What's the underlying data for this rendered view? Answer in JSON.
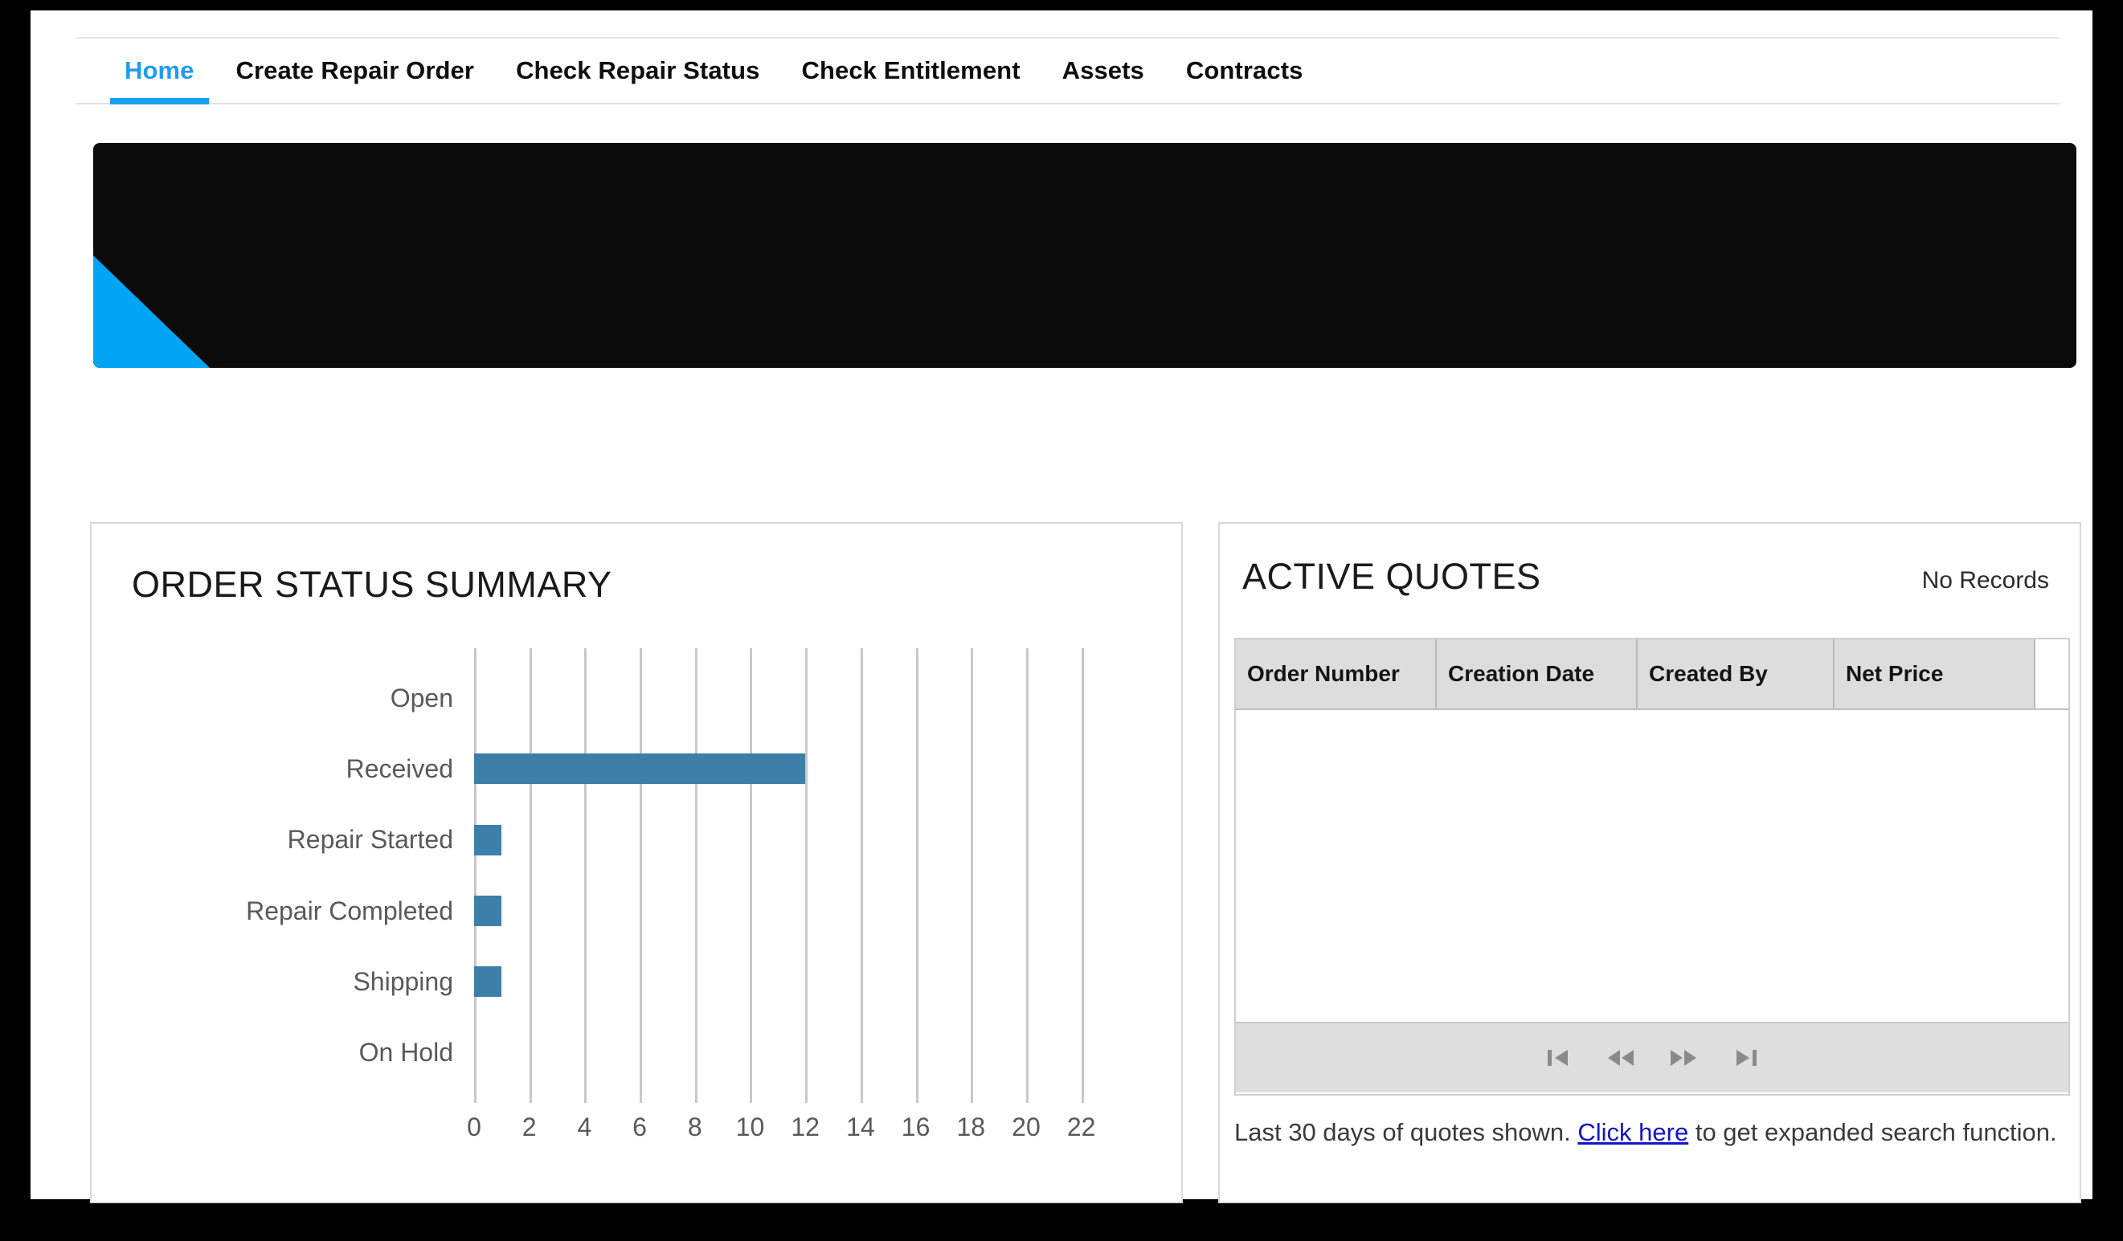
{
  "nav": {
    "items": [
      {
        "label": "Home",
        "active": true
      },
      {
        "label": "Create Repair Order",
        "active": false
      },
      {
        "label": "Check Repair Status",
        "active": false
      },
      {
        "label": "Check Entitlement",
        "active": false
      },
      {
        "label": "Assets",
        "active": false
      },
      {
        "label": "Contracts",
        "active": false
      }
    ],
    "active_color": "#1b9df4"
  },
  "hero": {
    "background_color": "#0b0b0b",
    "accent_color": "#00a5f5",
    "accent_shape": "triangle-bottom-left"
  },
  "order_status_panel": {
    "title": "ORDER STATUS SUMMARY"
  },
  "chart_data": {
    "type": "bar",
    "orientation": "horizontal",
    "title": "ORDER STATUS SUMMARY",
    "xlabel": "",
    "ylabel": "",
    "categories": [
      "Open",
      "Received",
      "Repair Started",
      "Repair Completed",
      "Shipping",
      "On Hold"
    ],
    "values": [
      0,
      12,
      1,
      1,
      1,
      0
    ],
    "xlim": [
      0,
      23
    ],
    "xticks": [
      0,
      2,
      4,
      6,
      8,
      10,
      12,
      14,
      16,
      18,
      20,
      22
    ],
    "xtick_labels": [
      "0",
      "2",
      "4",
      "6",
      "8",
      "10",
      "12",
      "14",
      "16",
      "18",
      "20",
      "22"
    ],
    "grid": true,
    "grid_axis": "x",
    "legend": false,
    "bar_color": "#3d7fa8",
    "gridline_color": "#c8c8c8",
    "tick_label_color": "#595959"
  },
  "active_quotes_panel": {
    "title": "ACTIVE QUOTES",
    "status_label": "No Records",
    "table": {
      "columns": [
        "Order Number",
        "Creation Date",
        "Created By",
        "Net Price"
      ],
      "rows": []
    },
    "pager": {
      "buttons": [
        {
          "name": "first-page",
          "glyph": "first"
        },
        {
          "name": "previous-page",
          "glyph": "prev"
        },
        {
          "name": "next-page",
          "glyph": "next"
        },
        {
          "name": "last-page",
          "glyph": "last"
        }
      ]
    },
    "footnote": {
      "prefix": "Last 30 days of quotes shown. ",
      "link_text": "Click here",
      "suffix": " to get expanded search function."
    }
  }
}
